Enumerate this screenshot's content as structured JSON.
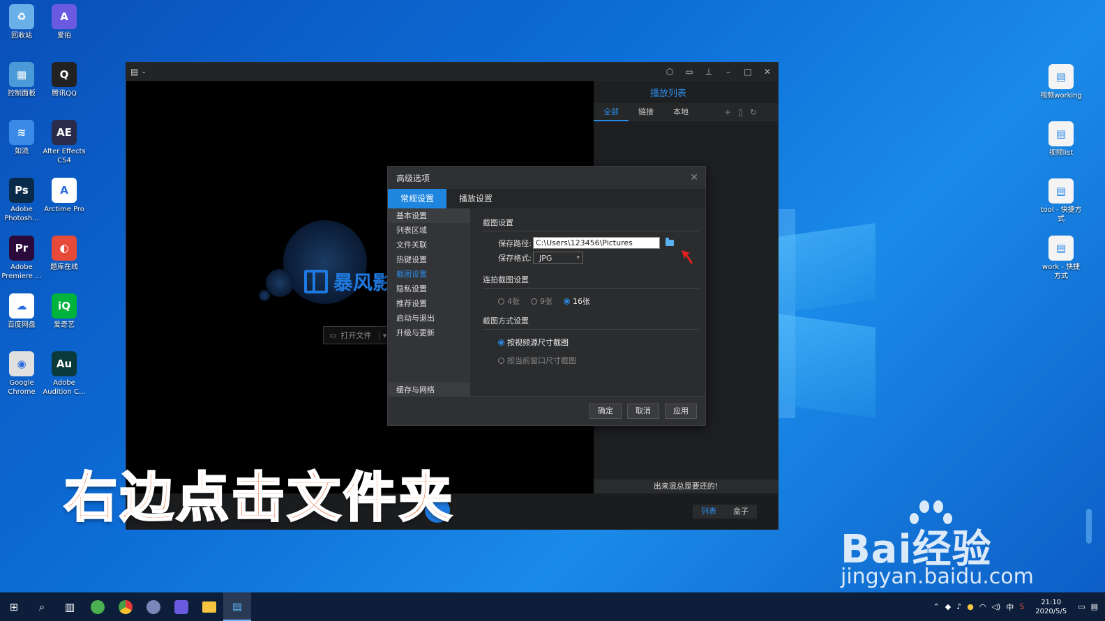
{
  "desktop": {
    "icons_left": [
      {
        "label": "回收站",
        "icon": "recycle-bin-icon",
        "color": "#6ab0e8",
        "glyph": "♻"
      },
      {
        "label": "爱拍",
        "icon": "aipai-icon",
        "color": "#6a5ae0",
        "glyph": "A"
      },
      {
        "label": "控制面板",
        "icon": "control-panel-icon",
        "color": "#4a9ad8",
        "glyph": "▦"
      },
      {
        "label": "腾讯QQ",
        "icon": "qq-icon",
        "color": "#222222",
        "glyph": "Q"
      },
      {
        "label": "如流",
        "icon": "ruliu-icon",
        "color": "#3a8ae8",
        "glyph": "≋"
      },
      {
        "label": "After Effects CS4",
        "icon": "after-effects-icon",
        "color": "#2a2a4a",
        "glyph": "AE"
      },
      {
        "label": "Adobe Photosh...",
        "icon": "photoshop-icon",
        "color": "#0a2a4a",
        "glyph": "Ps"
      },
      {
        "label": "Arctime Pro",
        "icon": "arctime-icon",
        "color": "#ffffff",
        "glyph": "A"
      },
      {
        "label": "Adobe Premiere ...",
        "icon": "premiere-icon",
        "color": "#2a0a3a",
        "glyph": "Pr"
      },
      {
        "label": "题库在线",
        "icon": "tiku-icon",
        "color": "#e84a3a",
        "glyph": "◐"
      },
      {
        "label": "百度网盘",
        "icon": "baidu-netdisk-icon",
        "color": "#ffffff",
        "glyph": "☁"
      },
      {
        "label": "爱奇艺",
        "icon": "iqiyi-icon",
        "color": "#00b33c",
        "glyph": "iQ"
      },
      {
        "label": "Google Chrome",
        "icon": "chrome-icon",
        "color": "#e0e0e0",
        "glyph": "◉"
      },
      {
        "label": "Adobe Audition C...",
        "icon": "audition-icon",
        "color": "#0a3a3a",
        "glyph": "Au"
      }
    ],
    "icons_right": [
      {
        "label": "视频working",
        "icon": "folder-shortcut-icon"
      },
      {
        "label": "视频list",
        "icon": "folder-shortcut-icon"
      },
      {
        "label": "tool - 快捷方式",
        "icon": "folder-shortcut-icon"
      },
      {
        "label": "work - 快捷方式",
        "icon": "folder-shortcut-icon"
      }
    ]
  },
  "player": {
    "brand": "暴风影",
    "open_file": "打开文件",
    "playlist": {
      "title": "播放列表",
      "tabs": [
        "全部",
        "链接",
        "本地"
      ],
      "slogan": "出来混总是要还的!"
    },
    "control_tabs": [
      "列表",
      "盒子"
    ]
  },
  "dialog": {
    "title": "高级选项",
    "tabs": [
      "常规设置",
      "播放设置"
    ],
    "sidebar": [
      "基本设置",
      "列表区域",
      "文件关联",
      "热键设置",
      "截图设置",
      "隐私设置",
      "推荐设置",
      "启动与退出",
      "升级与更新"
    ],
    "sidebar_bottom": "缓存与网络",
    "screenshot_section": "截图设置",
    "save_path_label": "保存路径:",
    "save_path_value": "C:\\Users\\123456\\Pictures",
    "format_label": "保存格式:",
    "format_value": "JPG",
    "burst_section": "连拍截图设置",
    "burst_options": [
      "4张",
      "9张",
      "16张"
    ],
    "mode_section": "截图方式设置",
    "mode_options": [
      "按视频源尺寸截图",
      "按当前窗口尺寸截图"
    ],
    "buttons": [
      "确定",
      "取消",
      "应用"
    ]
  },
  "caption": "右边点击文件夹",
  "watermark": {
    "brand": "Bai经验",
    "url": "jingyan.baidu.com"
  },
  "taskbar": {
    "time": "21:10",
    "date": "2020/5/5",
    "ime": "中"
  },
  "colors": {
    "accent": "#1f86e0",
    "caption": "#e8622c"
  }
}
